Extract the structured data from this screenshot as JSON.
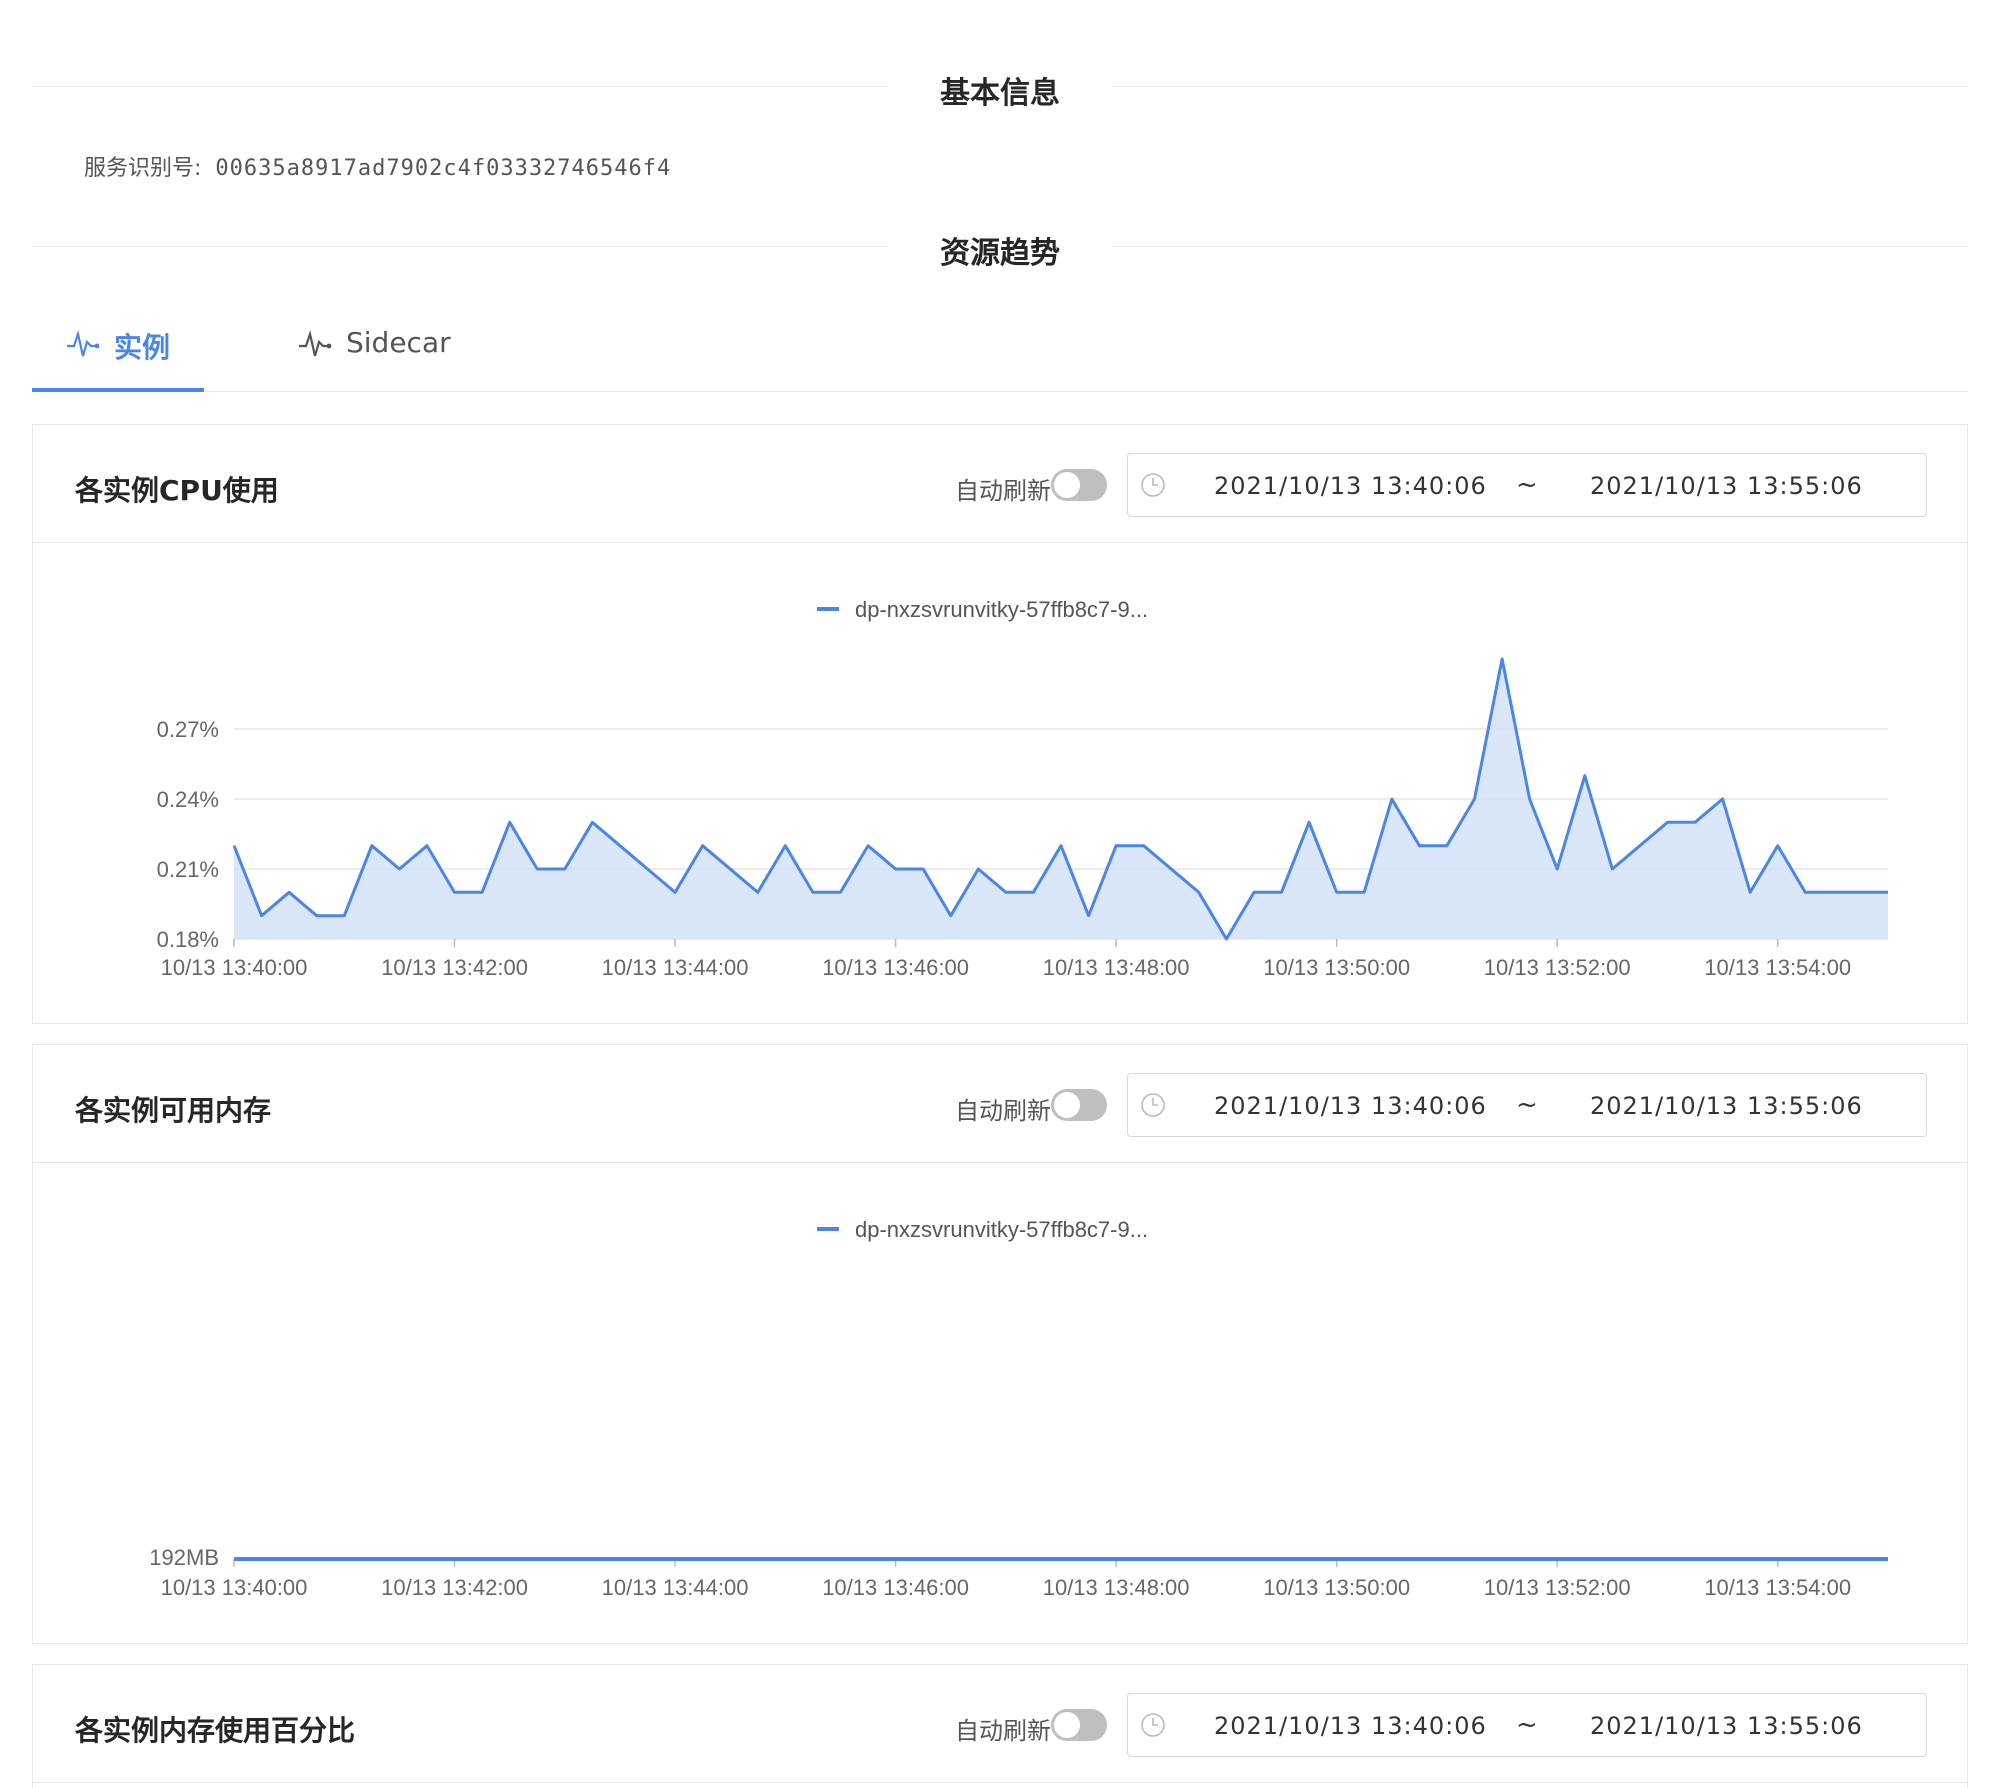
{
  "sections": {
    "basic_info_title": "基本信息",
    "resource_trend_title": "资源趋势"
  },
  "service": {
    "label": "服务识别号:",
    "id": "00635a8917ad7902c4f03332746546f4"
  },
  "tabs": [
    {
      "label": "实例",
      "icon": "pulse-icon",
      "active": true
    },
    {
      "label": "Sidecar",
      "icon": "pulse-icon",
      "active": false
    }
  ],
  "colors": {
    "accent": "#4a86e8",
    "area": "#d4e3f8"
  },
  "cards": [
    {
      "title": "各实例CPU使用",
      "auto_refresh_label": "自动刷新",
      "auto_refresh_on": false,
      "range_from": "2021/10/13 13:40:06",
      "range_sep": "~",
      "range_to": "2021/10/13 13:55:06"
    },
    {
      "title": "各实例可用内存",
      "auto_refresh_label": "自动刷新",
      "auto_refresh_on": false,
      "range_from": "2021/10/13 13:40:06",
      "range_sep": "~",
      "range_to": "2021/10/13 13:55:06"
    },
    {
      "title": "各实例内存使用百分比",
      "auto_refresh_label": "自动刷新",
      "auto_refresh_on": false,
      "range_from": "2021/10/13 13:40:06",
      "range_sep": "~",
      "range_to": "2021/10/13 13:55:06"
    }
  ],
  "chart_data": [
    {
      "type": "area",
      "legend": [
        "dp-nxzsvrunvitky-57ffb8c7-9..."
      ],
      "x_ticks": [
        "10/13 13:40:00",
        "10/13 13:42:00",
        "10/13 13:44:00",
        "10/13 13:46:00",
        "10/13 13:48:00",
        "10/13 13:50:00",
        "10/13 13:52:00",
        "10/13 13:54:00"
      ],
      "y_ticks": [
        "0.18%",
        "0.21%",
        "0.24%",
        "0.27%"
      ],
      "ylim": [
        0.18,
        0.27
      ],
      "x_minutes_range": [
        0,
        15
      ],
      "series": [
        {
          "name": "dp-nxzsvrunvitky-57ffb8c7-9...",
          "x_minutes": [
            0,
            0.25,
            0.5,
            0.75,
            1,
            1.25,
            1.5,
            1.75,
            2,
            2.25,
            2.5,
            2.75,
            3,
            3.25,
            3.75,
            4,
            4.25,
            4.75,
            5,
            5.25,
            5.5,
            5.75,
            6,
            6.25,
            6.5,
            6.75,
            7,
            7.25,
            7.5,
            7.75,
            8,
            8.25,
            8.75,
            9,
            9.25,
            9.5,
            9.75,
            10,
            10.25,
            10.5,
            10.75,
            11,
            11.25,
            11.5,
            11.75,
            12,
            12.25,
            12.5,
            12.75,
            13,
            13.25,
            13.5,
            13.75,
            14,
            14.25,
            14.5,
            14.75,
            15
          ],
          "values": [
            0.22,
            0.19,
            0.2,
            0.19,
            0.19,
            0.22,
            0.21,
            0.22,
            0.2,
            0.2,
            0.23,
            0.21,
            0.21,
            0.23,
            0.21,
            0.2,
            0.22,
            0.2,
            0.22,
            0.2,
            0.2,
            0.22,
            0.21,
            0.21,
            0.19,
            0.21,
            0.2,
            0.2,
            0.22,
            0.19,
            0.22,
            0.22,
            0.2,
            0.18,
            0.2,
            0.2,
            0.23,
            0.2,
            0.2,
            0.24,
            0.22,
            0.22,
            0.24,
            0.3,
            0.24,
            0.21,
            0.25,
            0.21,
            0.22,
            0.23,
            0.23,
            0.24,
            0.2,
            0.22,
            0.2,
            0.2,
            0.2,
            0.2
          ]
        }
      ]
    },
    {
      "type": "line",
      "legend": [
        "dp-nxzsvrunvitky-57ffb8c7-9..."
      ],
      "x_ticks": [
        "10/13 13:40:00",
        "10/13 13:42:00",
        "10/13 13:44:00",
        "10/13 13:46:00",
        "10/13 13:48:00",
        "10/13 13:50:00",
        "10/13 13:52:00",
        "10/13 13:54:00"
      ],
      "y_ticks": [
        "192MB"
      ],
      "x_minutes_range": [
        0,
        15
      ],
      "series": [
        {
          "name": "dp-nxzsvrunvitky-57ffb8c7-9...",
          "x_minutes": [
            0,
            15
          ],
          "values": [
            192,
            192
          ]
        }
      ]
    }
  ]
}
